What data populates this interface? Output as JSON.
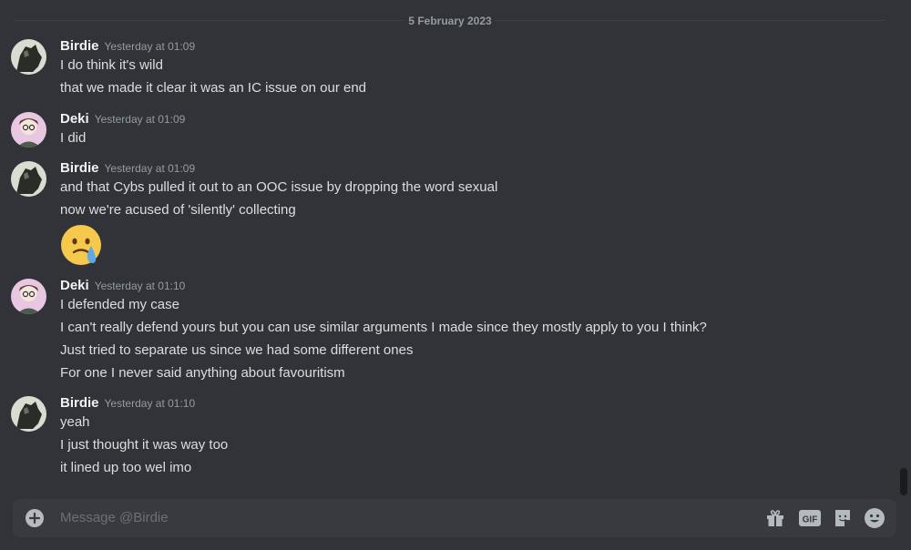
{
  "date_divider": "5 February 2023",
  "groups": [
    {
      "author": "Birdie",
      "timestamp": "Yesterday at 01:09",
      "lines": [
        "I do think it's wild",
        "that we made it clear it was an IC issue on our end"
      ]
    },
    {
      "author": "Deki",
      "timestamp": "Yesterday at 01:09",
      "lines": [
        "I did"
      ]
    },
    {
      "author": "Birdie",
      "timestamp": "Yesterday at 01:09",
      "lines": [
        "and that Cybs pulled it out to an OOC issue by dropping the word sexual",
        "now we're acused of 'silently' collecting"
      ],
      "emoji": "face-holding-back-tears"
    },
    {
      "author": "Deki",
      "timestamp": "Yesterday at 01:10",
      "lines": [
        "I defended my case",
        "I can't really defend yours but you can use similar arguments I made since they mostly apply to you I think?",
        "Just tried to separate us since we had some different ones",
        "For one I never said anything about favouritism"
      ]
    },
    {
      "author": "Birdie",
      "timestamp": "Yesterday at 01:10",
      "lines": [
        "yeah",
        "I just thought it was way too",
        "it lined up too wel imo"
      ]
    }
  ],
  "composer": {
    "placeholder": "Message @Birdie"
  },
  "icons": {
    "add": "plus-circle-icon",
    "gift": "gift-icon",
    "gif": "GIF",
    "sticker": "sticker-icon",
    "emoji": "smile-icon"
  },
  "colors": {
    "background": "#313338",
    "composer": "#383a40",
    "author": "#f2f3f5",
    "text": "#dbdee1",
    "muted": "#949ba4"
  }
}
